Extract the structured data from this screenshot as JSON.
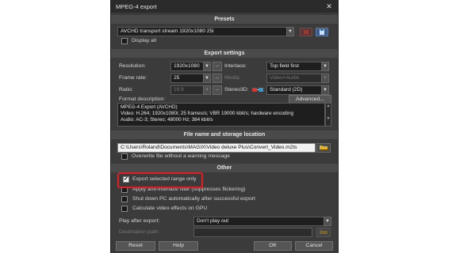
{
  "window": {
    "title": "MPEG-4 export",
    "close_label": "✕"
  },
  "presets": {
    "header": "Presets",
    "selected": "AVCHD transport stream 1920x1080 25i",
    "display_all": "Display all"
  },
  "export_settings": {
    "header": "Export settings",
    "resolution_label": "Resolution:",
    "resolution_value": "1920x1080",
    "frame_rate_label": "Frame rate:",
    "frame_rate_value": "25",
    "ratio_label": "Ratio:",
    "ratio_value": "16:9",
    "interlace_label": "Interlace:",
    "interlace_value": "Top field first",
    "media_label": "Media:",
    "media_value": "Video+Audio",
    "stereo_label": "Stereo3D:",
    "stereo_value": "Standard (2D)",
    "more_label": "...",
    "format_desc_label": "Format description:",
    "advanced_label": "Advanced...",
    "format_lines": [
      "MPEG-4 Export (AVCHD)",
      "Video: H.264; 1920x1080i; 25 frames/s; VBR 19000 kbit/s; hardware encoding",
      "Audio: AC-3; Stereo; 48000 Hz; 384 kbit/s"
    ]
  },
  "file": {
    "header": "File name and storage location",
    "path": "C:\\Users\\Roland\\Documents\\MAGIX\\Video deluxe Plus\\Convert_Video.m2ts",
    "overwrite": "Overwrite file without a warning message"
  },
  "other": {
    "header": "Other",
    "export_range": "Export selected range only",
    "anti_interlace": "Apply anti-interlace filter (suppresses flickering)",
    "shutdown": "Shut down PC automatically after successful export",
    "gpu": "Calculate video effects on GPU",
    "play_after_label": "Play after export:",
    "play_after_value": "Don't play out",
    "destination_label": "Destination path:"
  },
  "buttons": {
    "reset": "Reset",
    "help": "Help",
    "ok": "OK",
    "cancel": "Cancel"
  },
  "colors": {
    "highlight": "#e31b23",
    "delete_preset": "#c0392b",
    "save_preset": "#3a7bd5",
    "folder": "#e6b422"
  }
}
